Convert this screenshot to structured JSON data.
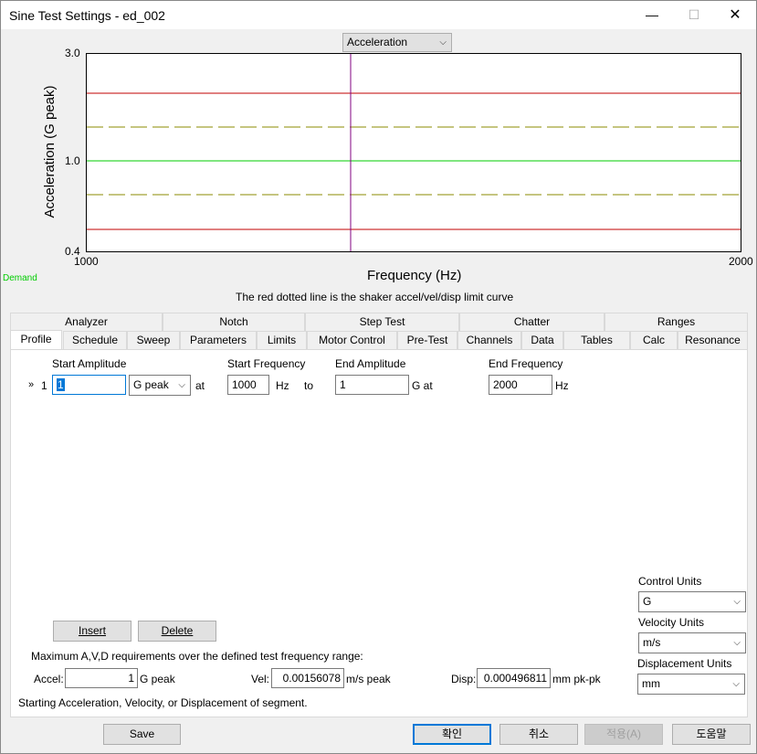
{
  "window": {
    "title": "Sine Test Settings - ed_002",
    "minimize_label": "—",
    "maximize_label": "☐",
    "close_label": "✕"
  },
  "graph": {
    "dropdown": "Acceleration",
    "y_label": "Acceleration (G peak)",
    "y_ticks": [
      "3.0",
      "1.0",
      "0.4"
    ],
    "x_ticks": [
      "1000",
      "2000"
    ],
    "x_label": "Frequency (Hz)",
    "demand_label": "Demand",
    "caption": "The red dotted line is the shaker accel/vel/disp limit curve",
    "colors": {
      "limit": "#c00000",
      "abort": "#8b8b00",
      "demand": "#00cc00",
      "cursor": "#800080"
    }
  },
  "tabs_row1": [
    "Analyzer",
    "Notch",
    "Step Test",
    "Chatter",
    "Ranges"
  ],
  "tabs_row2": [
    "Profile",
    "Schedule",
    "Sweep",
    "Parameters",
    "Limits",
    "Motor Control",
    "Pre-Test",
    "Channels",
    "Data",
    "Tables",
    "Calc",
    "Resonance"
  ],
  "active_tab": "Profile",
  "profile": {
    "headers": {
      "start_amp": "Start Amplitude",
      "start_freq": "Start Frequency",
      "end_amp": "End Amplitude",
      "end_freq": "End Frequency"
    },
    "row": {
      "marker": "»",
      "index": "1",
      "start_amp": "1",
      "unit": "G peak",
      "at1": "at",
      "start_freq": "1000",
      "hz1": "Hz",
      "to": "to",
      "end_amp": "1",
      "g_at": "G at",
      "end_freq": "2000",
      "hz2": "Hz"
    },
    "insert_label": "Insert",
    "delete_label": "Delete",
    "max_req": "Maximum A,V,D requirements over the defined test frequency range:",
    "accel_label": "Accel:",
    "accel_value": "1",
    "accel_unit": "G peak",
    "vel_label": "Vel:",
    "vel_value": "0.00156078",
    "vel_unit": "m/s peak",
    "disp_label": "Disp:",
    "disp_value": "0.000496811",
    "disp_unit": "mm pk-pk",
    "status": "Starting Acceleration, Velocity, or Displacement of segment.",
    "control_units_label": "Control Units",
    "control_units": "G",
    "velocity_units_label": "Velocity Units",
    "velocity_units": "m/s",
    "displacement_units_label": "Displacement Units",
    "displacement_units": "mm"
  },
  "footer": {
    "save": "Save",
    "ok": "확인",
    "cancel": "취소",
    "apply": "적용(A)",
    "help": "도움말"
  }
}
